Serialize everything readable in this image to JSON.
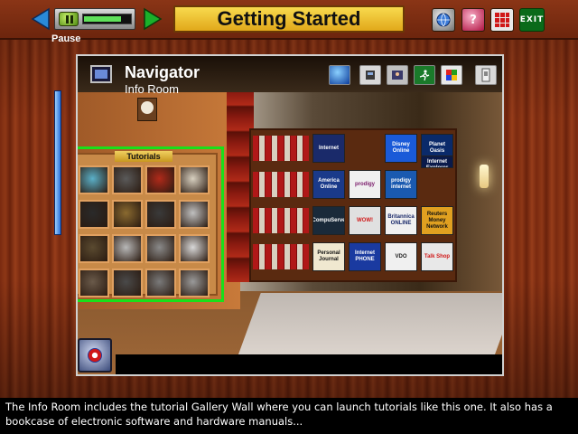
{
  "header": {
    "title": "Getting Started",
    "pause_label": "Pause",
    "exit_label": "EXIT",
    "help_label": "?",
    "progress_fraction": 0.78
  },
  "navigator": {
    "title": "Navigator",
    "subtitle": "Info Room"
  },
  "tutorials": {
    "label": "Tutorials"
  },
  "products": [
    {
      "text": "Internet",
      "bg": "#1a2a6a",
      "fg": "#ffffff"
    },
    {
      "text": "Disney Online",
      "bg": "#1a5ad8",
      "fg": "#ffffff"
    },
    {
      "text": "Planet Oasis",
      "bg": "#0a2a6a",
      "fg": "#ffffff"
    },
    {
      "text": "& Microsoft Internet Explorer",
      "bg": "#0a1a4a",
      "fg": "#ffffff"
    },
    {
      "text": "America Online",
      "bg": "#1a3a8a",
      "fg": "#ffffff"
    },
    {
      "text": "prodigy",
      "bg": "#f0f0f0",
      "fg": "#7a1a6a"
    },
    {
      "text": "prodigy internet",
      "bg": "#1a5ab0",
      "fg": "#ffffff"
    },
    {
      "text": "CompuServe",
      "bg": "#1a2a3a",
      "fg": "#ffffff"
    },
    {
      "text": "WOW!",
      "bg": "#e0e0e0",
      "fg": "#d01818"
    },
    {
      "text": "Britannica ONLINE",
      "bg": "#f0f0f0",
      "fg": "#1a2a6a"
    },
    {
      "text": "Reuters Money Network",
      "bg": "#e0a020",
      "fg": "#111111"
    },
    {
      "text": "Personal Journal",
      "bg": "#f0e8d0",
      "fg": "#111111"
    },
    {
      "text": "Internet PHONE",
      "bg": "#1a3aa0",
      "fg": "#ffffff"
    },
    {
      "text": "VDO",
      "bg": "#f0f0f0",
      "fg": "#1a1a1a"
    },
    {
      "text": "Talk Shop",
      "bg": "#e8e8e8",
      "fg": "#d01818"
    }
  ],
  "caption": {
    "text": "The Info Room includes the tutorial Gallery Wall where you can launch tutorials like this one.  It also has a bookcase of electronic software and hardware manuals..."
  }
}
